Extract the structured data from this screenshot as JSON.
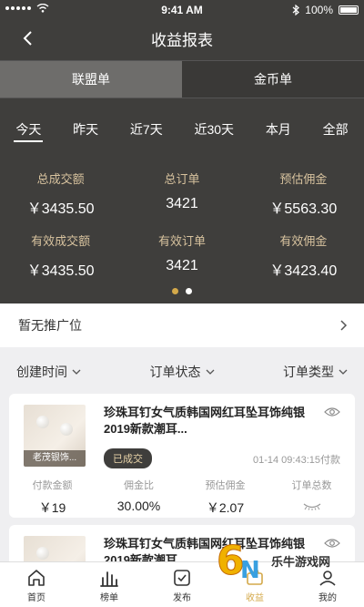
{
  "status_bar": {
    "time": "9:41 AM",
    "battery": "100%"
  },
  "header": {
    "title": "收益报表"
  },
  "segments": [
    {
      "label": "联盟单"
    },
    {
      "label": "金币单"
    }
  ],
  "ranges": [
    {
      "label": "今天"
    },
    {
      "label": "昨天"
    },
    {
      "label": "近7天"
    },
    {
      "label": "近30天"
    },
    {
      "label": "本月"
    },
    {
      "label": "全部"
    }
  ],
  "stats_row1": [
    {
      "label": "总成交额",
      "value": "￥3435.50"
    },
    {
      "label": "总订单",
      "value": "3421"
    },
    {
      "label": "预估佣金",
      "value": "￥5563.30"
    }
  ],
  "stats_row2": [
    {
      "label": "有效成交额",
      "value": "￥3435.50"
    },
    {
      "label": "有效订单",
      "value": "3421"
    },
    {
      "label": "有效佣金",
      "value": "￥3423.40"
    }
  ],
  "promo": {
    "text": "暂无推广位"
  },
  "filters": [
    {
      "label": "创建时间"
    },
    {
      "label": "订单状态"
    },
    {
      "label": "订单类型"
    }
  ],
  "orders": [
    {
      "title": "珍珠耳钉女气质韩国网红耳坠耳饰纯银2019新款潮耳...",
      "thumb_tag": "老茂银饰...",
      "status": "已成交",
      "time": "01-14 09:43:15付款",
      "metrics": [
        {
          "label": "付款金额",
          "value": "￥19"
        },
        {
          "label": "佣金比",
          "value": "30.00%"
        },
        {
          "label": "预估佣金",
          "value": "￥2.07"
        },
        {
          "label": "订单总数",
          "value": ""
        }
      ]
    },
    {
      "title": "珍珠耳钉女气质韩国网红耳坠耳饰纯银2019新款潮耳..."
    }
  ],
  "tabbar": [
    {
      "label": "首页"
    },
    {
      "label": "榜单"
    },
    {
      "label": "发布"
    },
    {
      "label": "收益"
    },
    {
      "label": "我的"
    }
  ],
  "watermark": {
    "text": "乐牛游戏网"
  },
  "colors": {
    "dark_bg": "#3f3e3c",
    "accent_gold": "#d4a94a",
    "label_gold": "#d7c29e"
  }
}
